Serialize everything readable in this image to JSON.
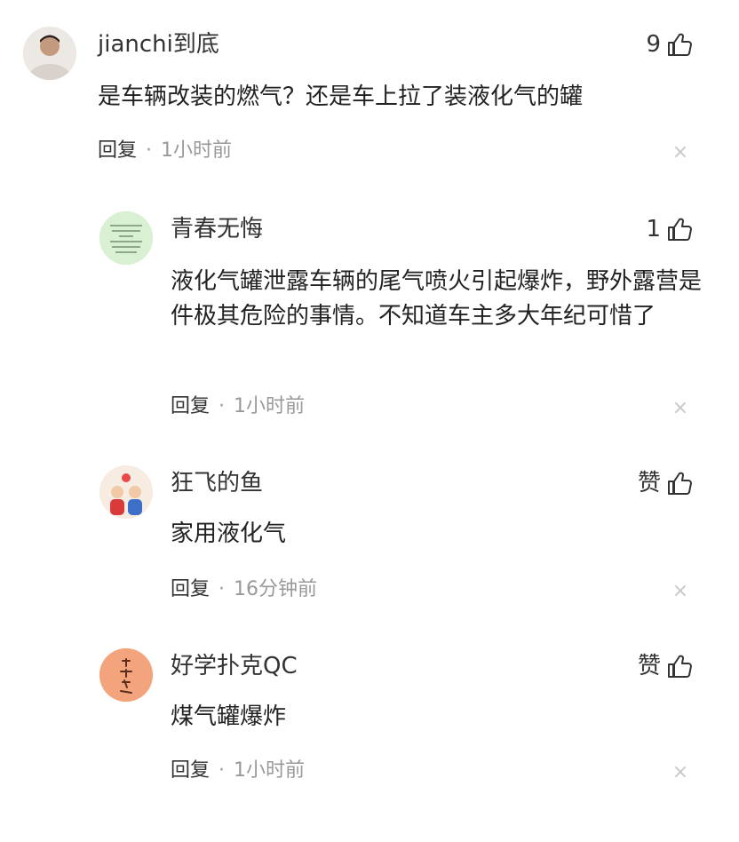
{
  "comments": [
    {
      "username": "jianchi到底",
      "likes": "9",
      "text": "是车辆改装的燃气？还是车上拉了装液化气的罐",
      "reply_label": "回复",
      "separator": "·",
      "time": "1小时前",
      "avatar_icon": "person-photo-icon"
    },
    {
      "username": "青春无悔",
      "likes": "1",
      "text": "液化气罐泄露车辆的尾气喷火引起爆炸，野外露营是件极其危险的事情。不知道车主多大年纪可惜了",
      "reply_label": "回复",
      "separator": "·",
      "time": "1小时前",
      "avatar_icon": "green-document-icon"
    },
    {
      "username": "狂飞的鱼",
      "likes": "赞",
      "text": "家用液化气",
      "reply_label": "回复",
      "separator": "·",
      "time": "16分钟前",
      "avatar_icon": "cartoon-family-icon"
    },
    {
      "username": "好学扑克QC",
      "likes": "赞",
      "text": "煤气罐爆炸",
      "reply_label": "回复",
      "separator": "·",
      "time": "1小时前",
      "avatar_icon": "calligraphy-avatar-icon"
    }
  ],
  "close_glyph": "×",
  "colors": {
    "meta": "#999999",
    "close": "#c8c8c8",
    "avatar2_bg": "#d9f0d3",
    "avatar4_bg": "#f4a47c"
  }
}
